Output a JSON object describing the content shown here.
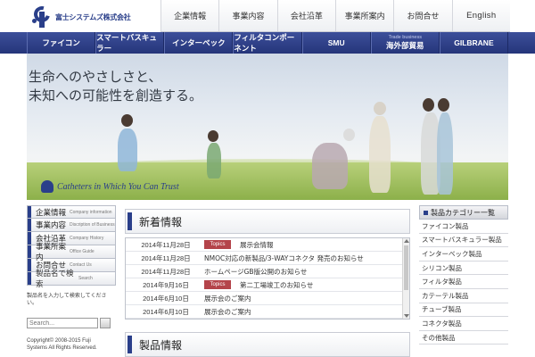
{
  "brand": {
    "name": "富士システムズ株式会社"
  },
  "topnav": [
    "企業情報",
    "事業内容",
    "会社沿革",
    "事業所案内",
    "お問合せ",
    "English"
  ],
  "mainnav": [
    {
      "label": "ファイコン",
      "sub": ""
    },
    {
      "label": "スマートバスキュラー",
      "sub": ""
    },
    {
      "label": "インターベック",
      "sub": ""
    },
    {
      "label": "フィルタコンポーネント",
      "sub": ""
    },
    {
      "label": "SMU",
      "sub": ""
    },
    {
      "label": "海外部貿易",
      "sub": "Trade business"
    },
    {
      "label": "GILBRANE",
      "sub": ""
    }
  ],
  "hero": {
    "line1": "生命へのやさしさと、",
    "line2": "未知への可能性を創造する。",
    "tagline": "Catheters in Which You Can Trust"
  },
  "sidebar": {
    "items": [
      {
        "jp": "企業情報",
        "en": "Company information"
      },
      {
        "jp": "事業内容",
        "en": "Discription of Business"
      },
      {
        "jp": "会社沿革",
        "en": "Company History"
      },
      {
        "jp": "事業所案内",
        "en": "Office Guide"
      },
      {
        "jp": "お問合せ",
        "en": "Contact Us"
      }
    ],
    "search_title": {
      "jp": "製品名で検索",
      "en": "Search"
    },
    "search_desc": "製品名を入力して検索してください。",
    "search_placeholder": "Search...",
    "copyright_line1": "Copyright© 2008-2015 Fuji",
    "copyright_line2": "Systems All Rights Reserved."
  },
  "news": {
    "title": "新着情報",
    "rows": [
      {
        "date": "2014年11月28日",
        "badge": "Topics",
        "text": "展示会情報"
      },
      {
        "date": "2014年11月28日",
        "badge": "",
        "text": "NMOC対応の新製品/3-WAYコネクタ 発売のお知らせ"
      },
      {
        "date": "2014年11月28日",
        "badge": "",
        "text": "ホームページGB版公開のお知らせ"
      },
      {
        "date": "2014年9月16日",
        "badge": "Topics",
        "text": "第二工場竣工のお知らせ"
      },
      {
        "date": "2014年6月10日",
        "badge": "",
        "text": "展示会のご案内"
      },
      {
        "date": "2014年6月10日",
        "badge": "",
        "text": "展示会のご案内"
      }
    ]
  },
  "section2": {
    "title": "製品情報"
  },
  "right_col": {
    "title": "製品カテゴリー一覧",
    "items": [
      "ファイコン製品",
      "スマートバスキュラー製品",
      "インターベック製品",
      "シリコン製品",
      "フィルタ製品",
      "カテーテル製品",
      "チューブ製品",
      "コネクタ製品",
      "その他製品"
    ]
  }
}
